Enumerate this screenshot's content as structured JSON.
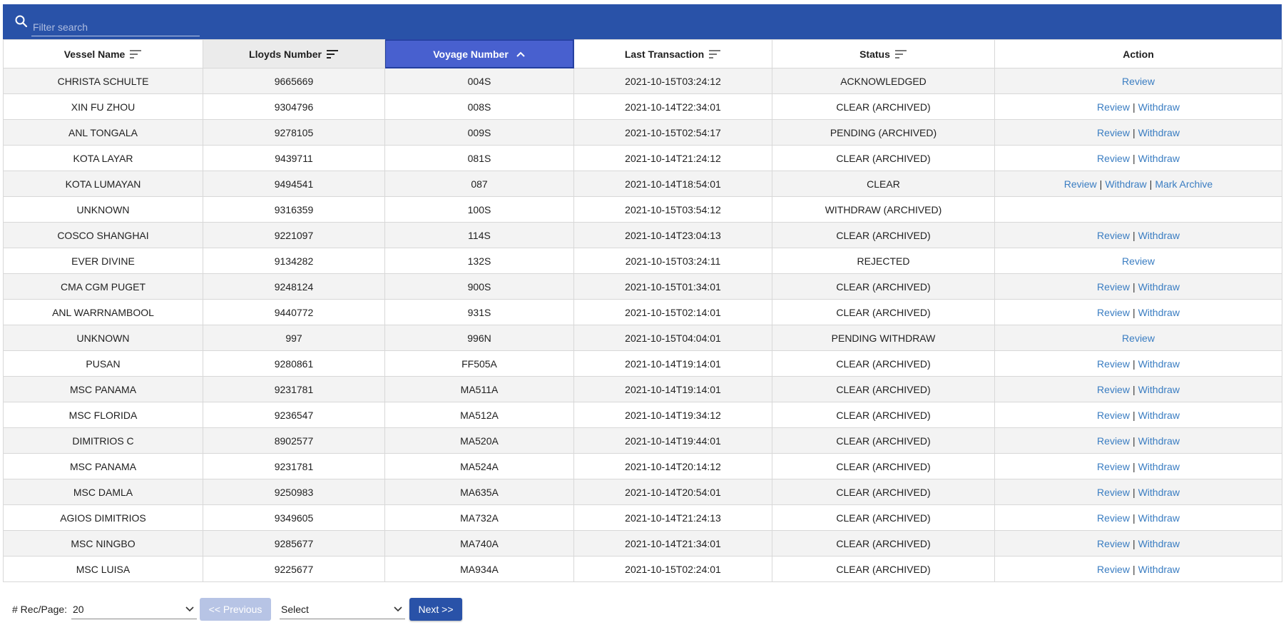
{
  "search": {
    "placeholder": "Filter search"
  },
  "columns": [
    {
      "label": "Vessel Name"
    },
    {
      "label": "Lloyds Number"
    },
    {
      "label": "Voyage Number"
    },
    {
      "label": "Last Transaction"
    },
    {
      "label": "Status"
    },
    {
      "label": "Action"
    }
  ],
  "actions": {
    "review": "Review",
    "withdraw": "Withdraw",
    "mark_archive": "Mark Archive",
    "separator": "|"
  },
  "rows": [
    {
      "vessel": "CHRISTA SCHULTE",
      "lloyds": "9665669",
      "voyage": "004S",
      "last": "2021-10-15T03:24:12",
      "status": "ACKNOWLEDGED",
      "actions": [
        "review"
      ]
    },
    {
      "vessel": "XIN FU ZHOU",
      "lloyds": "9304796",
      "voyage": "008S",
      "last": "2021-10-14T22:34:01",
      "status": "CLEAR (ARCHIVED)",
      "actions": [
        "review",
        "withdraw"
      ]
    },
    {
      "vessel": "ANL TONGALA",
      "lloyds": "9278105",
      "voyage": "009S",
      "last": "2021-10-15T02:54:17",
      "status": "PENDING (ARCHIVED)",
      "actions": [
        "review",
        "withdraw"
      ]
    },
    {
      "vessel": "KOTA LAYAR",
      "lloyds": "9439711",
      "voyage": "081S",
      "last": "2021-10-14T21:24:12",
      "status": "CLEAR (ARCHIVED)",
      "actions": [
        "review",
        "withdraw"
      ]
    },
    {
      "vessel": "KOTA LUMAYAN",
      "lloyds": "9494541",
      "voyage": "087",
      "last": "2021-10-14T18:54:01",
      "status": "CLEAR",
      "actions": [
        "review",
        "withdraw",
        "mark_archive"
      ]
    },
    {
      "vessel": "UNKNOWN",
      "lloyds": "9316359",
      "voyage": "100S",
      "last": "2021-10-15T03:54:12",
      "status": "WITHDRAW (ARCHIVED)",
      "actions": []
    },
    {
      "vessel": "COSCO SHANGHAI",
      "lloyds": "9221097",
      "voyage": "114S",
      "last": "2021-10-14T23:04:13",
      "status": "CLEAR (ARCHIVED)",
      "actions": [
        "review",
        "withdraw"
      ]
    },
    {
      "vessel": "EVER DIVINE",
      "lloyds": "9134282",
      "voyage": "132S",
      "last": "2021-10-15T03:24:11",
      "status": "REJECTED",
      "actions": [
        "review"
      ]
    },
    {
      "vessel": "CMA CGM PUGET",
      "lloyds": "9248124",
      "voyage": "900S",
      "last": "2021-10-15T01:34:01",
      "status": "CLEAR (ARCHIVED)",
      "actions": [
        "review",
        "withdraw"
      ]
    },
    {
      "vessel": "ANL WARRNAMBOOL",
      "lloyds": "9440772",
      "voyage": "931S",
      "last": "2021-10-15T02:14:01",
      "status": "CLEAR (ARCHIVED)",
      "actions": [
        "review",
        "withdraw"
      ]
    },
    {
      "vessel": "UNKNOWN",
      "lloyds": "997",
      "voyage": "996N",
      "last": "2021-10-15T04:04:01",
      "status": "PENDING WITHDRAW",
      "actions": [
        "review"
      ]
    },
    {
      "vessel": "PUSAN",
      "lloyds": "9280861",
      "voyage": "FF505A",
      "last": "2021-10-14T19:14:01",
      "status": "CLEAR (ARCHIVED)",
      "actions": [
        "review",
        "withdraw"
      ]
    },
    {
      "vessel": "MSC PANAMA",
      "lloyds": "9231781",
      "voyage": "MA511A",
      "last": "2021-10-14T19:14:01",
      "status": "CLEAR (ARCHIVED)",
      "actions": [
        "review",
        "withdraw"
      ]
    },
    {
      "vessel": "MSC FLORIDA",
      "lloyds": "9236547",
      "voyage": "MA512A",
      "last": "2021-10-14T19:34:12",
      "status": "CLEAR (ARCHIVED)",
      "actions": [
        "review",
        "withdraw"
      ]
    },
    {
      "vessel": "DIMITRIOS C",
      "lloyds": "8902577",
      "voyage": "MA520A",
      "last": "2021-10-14T19:44:01",
      "status": "CLEAR (ARCHIVED)",
      "actions": [
        "review",
        "withdraw"
      ]
    },
    {
      "vessel": "MSC PANAMA",
      "lloyds": "9231781",
      "voyage": "MA524A",
      "last": "2021-10-14T20:14:12",
      "status": "CLEAR (ARCHIVED)",
      "actions": [
        "review",
        "withdraw"
      ]
    },
    {
      "vessel": "MSC DAMLA",
      "lloyds": "9250983",
      "voyage": "MA635A",
      "last": "2021-10-14T20:54:01",
      "status": "CLEAR (ARCHIVED)",
      "actions": [
        "review",
        "withdraw"
      ]
    },
    {
      "vessel": "AGIOS DIMITRIOS",
      "lloyds": "9349605",
      "voyage": "MA732A",
      "last": "2021-10-14T21:24:13",
      "status": "CLEAR (ARCHIVED)",
      "actions": [
        "review",
        "withdraw"
      ]
    },
    {
      "vessel": "MSC NINGBO",
      "lloyds": "9285677",
      "voyage": "MA740A",
      "last": "2021-10-14T21:34:01",
      "status": "CLEAR (ARCHIVED)",
      "actions": [
        "review",
        "withdraw"
      ]
    },
    {
      "vessel": "MSC LUISA",
      "lloyds": "9225677",
      "voyage": "MA934A",
      "last": "2021-10-15T02:24:01",
      "status": "CLEAR (ARCHIVED)",
      "actions": [
        "review",
        "withdraw"
      ]
    }
  ],
  "footer": {
    "rec_label": "# Rec/Page:",
    "rec_value": "20",
    "prev_label": "<< Previous",
    "select_value": "Select",
    "next_label": "Next >>"
  },
  "colors": {
    "topbar": "#2952a8",
    "active_header": "#4860cf",
    "link": "#3a7dc2",
    "prev_disabled": "#b7c4e5"
  },
  "icons": {
    "search": "search-icon",
    "sort": "sort-lines-icon",
    "sorted_asc": "chevron-up-icon",
    "dropdown": "chevron-down-icon"
  }
}
